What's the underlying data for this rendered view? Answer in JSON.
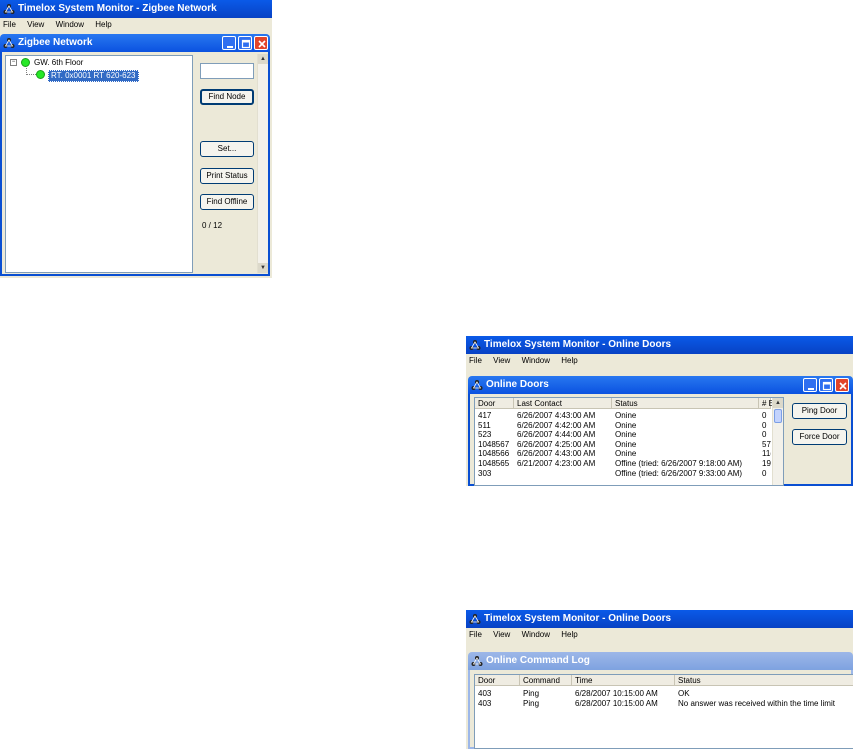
{
  "zigbee_window": {
    "app_title": "Timelox System Monitor - Zigbee Network",
    "menu": [
      "File",
      "View",
      "Window",
      "Help"
    ],
    "child_title": "Zigbee Network",
    "tree": {
      "root_label": "GW. 6th Floor",
      "child_label": "RT. 0x0001 RT 620-623"
    },
    "search_value": "",
    "buttons": {
      "find_node": "Find Node",
      "set": "Set...",
      "print_status": "Print Status",
      "find_offline": "Find Offline"
    },
    "count_text": "0 / 12"
  },
  "online_doors_window": {
    "app_title": "Timelox System Monitor - Online Doors",
    "menu": [
      "File",
      "View",
      "Window",
      "Help"
    ],
    "child_title": "Online Doors",
    "columns": [
      "Door",
      "Last Contact",
      "Status",
      "# E"
    ],
    "rows": [
      {
        "door": "417",
        "last_contact": "6/26/2007 4:43:00 AM",
        "status": "Onine",
        "count": "0"
      },
      {
        "door": "511",
        "last_contact": "6/26/2007 4:42:00 AM",
        "status": "Onine",
        "count": "0"
      },
      {
        "door": "523",
        "last_contact": "6/26/2007 4:44:00 AM",
        "status": "Onine",
        "count": "0"
      },
      {
        "door": "1048567",
        "last_contact": "6/26/2007 4:25:00 AM",
        "status": "Onine",
        "count": "57"
      },
      {
        "door": "1048566",
        "last_contact": "6/26/2007 4:43:00 AM",
        "status": "Onine",
        "count": "11("
      },
      {
        "door": "1048565",
        "last_contact": "6/21/2007 4:23:00 AM",
        "status": "Offine (tried: 6/26/2007 9:18:00 AM)",
        "count": "19"
      },
      {
        "door": "303",
        "last_contact": "",
        "status": "Offine (tried: 6/26/2007 9:33:00 AM)",
        "count": "0"
      }
    ],
    "buttons": {
      "ping_door": "Ping Door",
      "force_door": "Force Door"
    }
  },
  "command_log_window": {
    "app_title": "Timelox System Monitor - Online Doors",
    "menu": [
      "File",
      "View",
      "Window",
      "Help"
    ],
    "child_title": "Online Command Log",
    "columns": [
      "Door",
      "Command",
      "Time",
      "Status"
    ],
    "rows": [
      {
        "door": "403",
        "command": "Ping",
        "time": "6/28/2007 10:15:00 AM",
        "status": "OK"
      },
      {
        "door": "403",
        "command": "Ping",
        "time": "6/28/2007 10:15:00 AM",
        "status": "No answer was received within the time limit"
      }
    ]
  },
  "colors": {
    "titlebar_blue": "#0a5ae8",
    "close_red": "#e2442a",
    "status_dot_green": "#27e827"
  }
}
